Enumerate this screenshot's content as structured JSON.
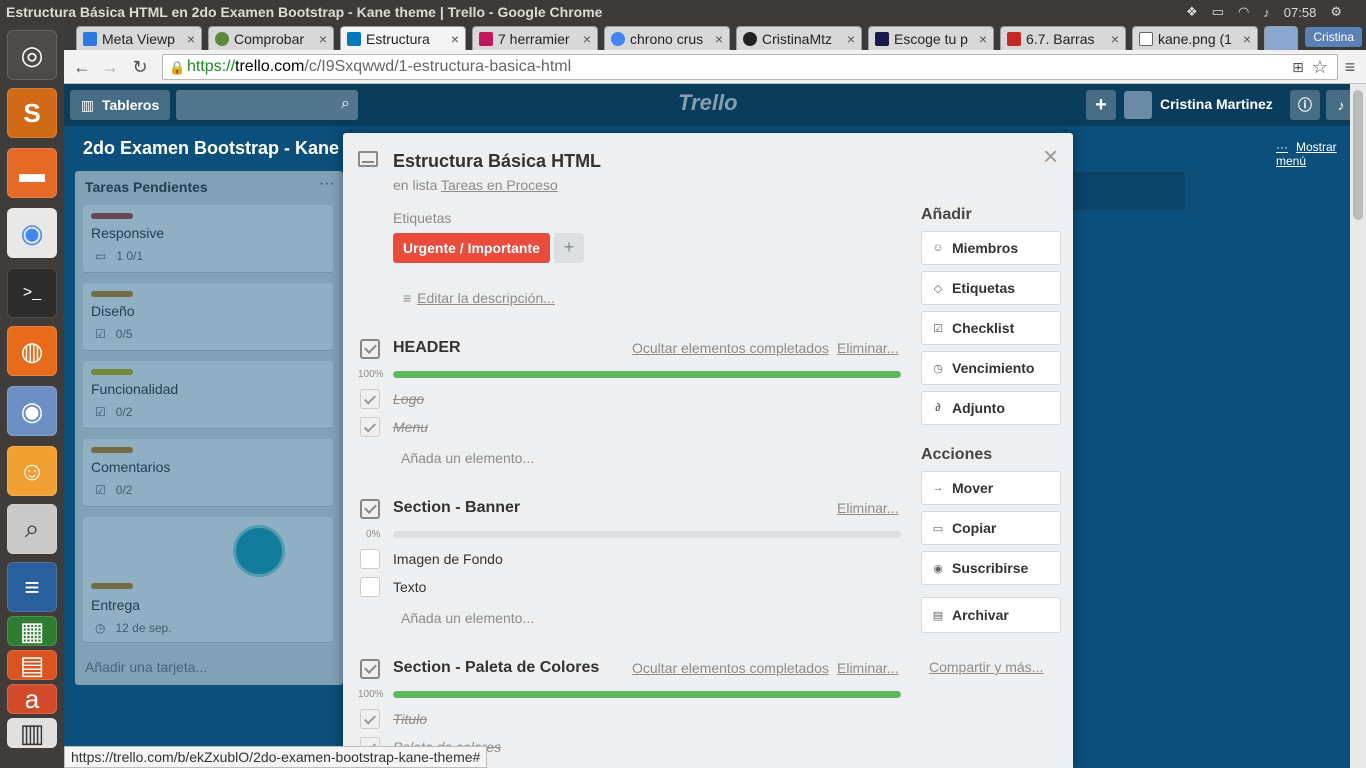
{
  "window": {
    "title": "Estructura Básica HTML en 2do Examen Bootstrap - Kane theme | Trello - Google Chrome",
    "time": "07:58"
  },
  "tabs": [
    {
      "label": "Meta Viewp",
      "color": "#2a7ae2",
      "active": false
    },
    {
      "label": "Comprobar",
      "color": "#5d8a3a",
      "active": false
    },
    {
      "label": "Estructura",
      "color": "#0079bf",
      "active": true
    },
    {
      "label": "7 herramier",
      "color": "#c2185b",
      "active": false
    },
    {
      "label": "chrono crus",
      "color": "#4285f4",
      "active": false
    },
    {
      "label": "CristinaMtz",
      "color": "#222222",
      "active": false
    },
    {
      "label": "Escoge tu p",
      "color": "#1a1a4a",
      "active": false
    },
    {
      "label": "6.7. Barras",
      "color": "#c62828",
      "active": false
    },
    {
      "label": "kane.png (1",
      "color": "#666666",
      "active": false
    }
  ],
  "profile_name": "Cristina",
  "address": {
    "scheme": "https://",
    "domain": "trello.com",
    "path": "/c/I9Sxqwwd/1-estructura-basica-html"
  },
  "trello": {
    "boards_btn": "Tableros",
    "logo": "Trello",
    "user": "Cristina Martinez",
    "board_title": "2do Examen Bootstrap - Kane",
    "show_menu": "Mostrar menú"
  },
  "list": {
    "title": "Tareas Pendientes",
    "cards": [
      {
        "title": "Responsive",
        "label_color": "#b04632",
        "badges": "1   0/1"
      },
      {
        "title": "Diseño",
        "label_color": "#cd8313",
        "badges": "0/5"
      },
      {
        "title": "Funcionalidad",
        "label_color": "#c9b800",
        "badges": "0/2"
      },
      {
        "title": "Comentarios",
        "label_color": "#cd8313",
        "badges": "0/2"
      },
      {
        "title": "Entrega",
        "label_color": "#cd8313",
        "badges": "12 de sep."
      }
    ],
    "add_card": "Añadir una tarjeta..."
  },
  "modal": {
    "title": "Estructura Básica HTML",
    "in_list_prefix": "en lista",
    "in_list_name": "Tareas en Proceso",
    "labels_heading": "Etiquetas",
    "label": "Urgente / Importante",
    "label_color": "#e74c3c",
    "add_label": "+",
    "edit_description": "Editar la descripción...",
    "checklists": [
      {
        "title": "HEADER",
        "hide": "Ocultar elementos completados",
        "delete": "Eliminar...",
        "percent": "100%",
        "progress": 1.0,
        "items": [
          {
            "text": "Logo",
            "done": true
          },
          {
            "text": "Menu",
            "done": true
          }
        ],
        "add_item": "Añada un elemento..."
      },
      {
        "title": "Section - Banner",
        "delete": "Eliminar...",
        "percent": "0%",
        "progress": 0.0,
        "items": [
          {
            "text": "Imagen de Fondo",
            "done": false
          },
          {
            "text": "Texto",
            "done": false
          }
        ],
        "add_item": "Añada un elemento..."
      },
      {
        "title": "Section - Paleta de Colores",
        "hide": "Ocultar elementos completados",
        "delete": "Eliminar...",
        "percent": "100%",
        "progress": 1.0,
        "items": [
          {
            "text": "Titulo",
            "done": true
          },
          {
            "text": "Paleta de colores",
            "done": true
          }
        ]
      }
    ],
    "add_heading": "Añadir",
    "add_buttons": [
      {
        "label": "Miembros",
        "icon": "person-icon"
      },
      {
        "label": "Etiquetas",
        "icon": "tag-icon"
      },
      {
        "label": "Checklist",
        "icon": "checklist-icon"
      },
      {
        "label": "Vencimiento",
        "icon": "clock-icon"
      },
      {
        "label": "Adjunto",
        "icon": "paperclip-icon"
      }
    ],
    "actions_heading": "Acciones",
    "action_buttons": [
      {
        "label": "Mover",
        "icon": "arrow-right-icon"
      },
      {
        "label": "Copiar",
        "icon": "card-icon"
      },
      {
        "label": "Suscribirse",
        "icon": "eye-icon"
      },
      {
        "label": "Archivar",
        "icon": "archive-icon"
      }
    ],
    "share": "Compartir y más..."
  },
  "status_url": "https://trello.com/b/ekZxublO/2do-examen-bootstrap-kane-theme#"
}
